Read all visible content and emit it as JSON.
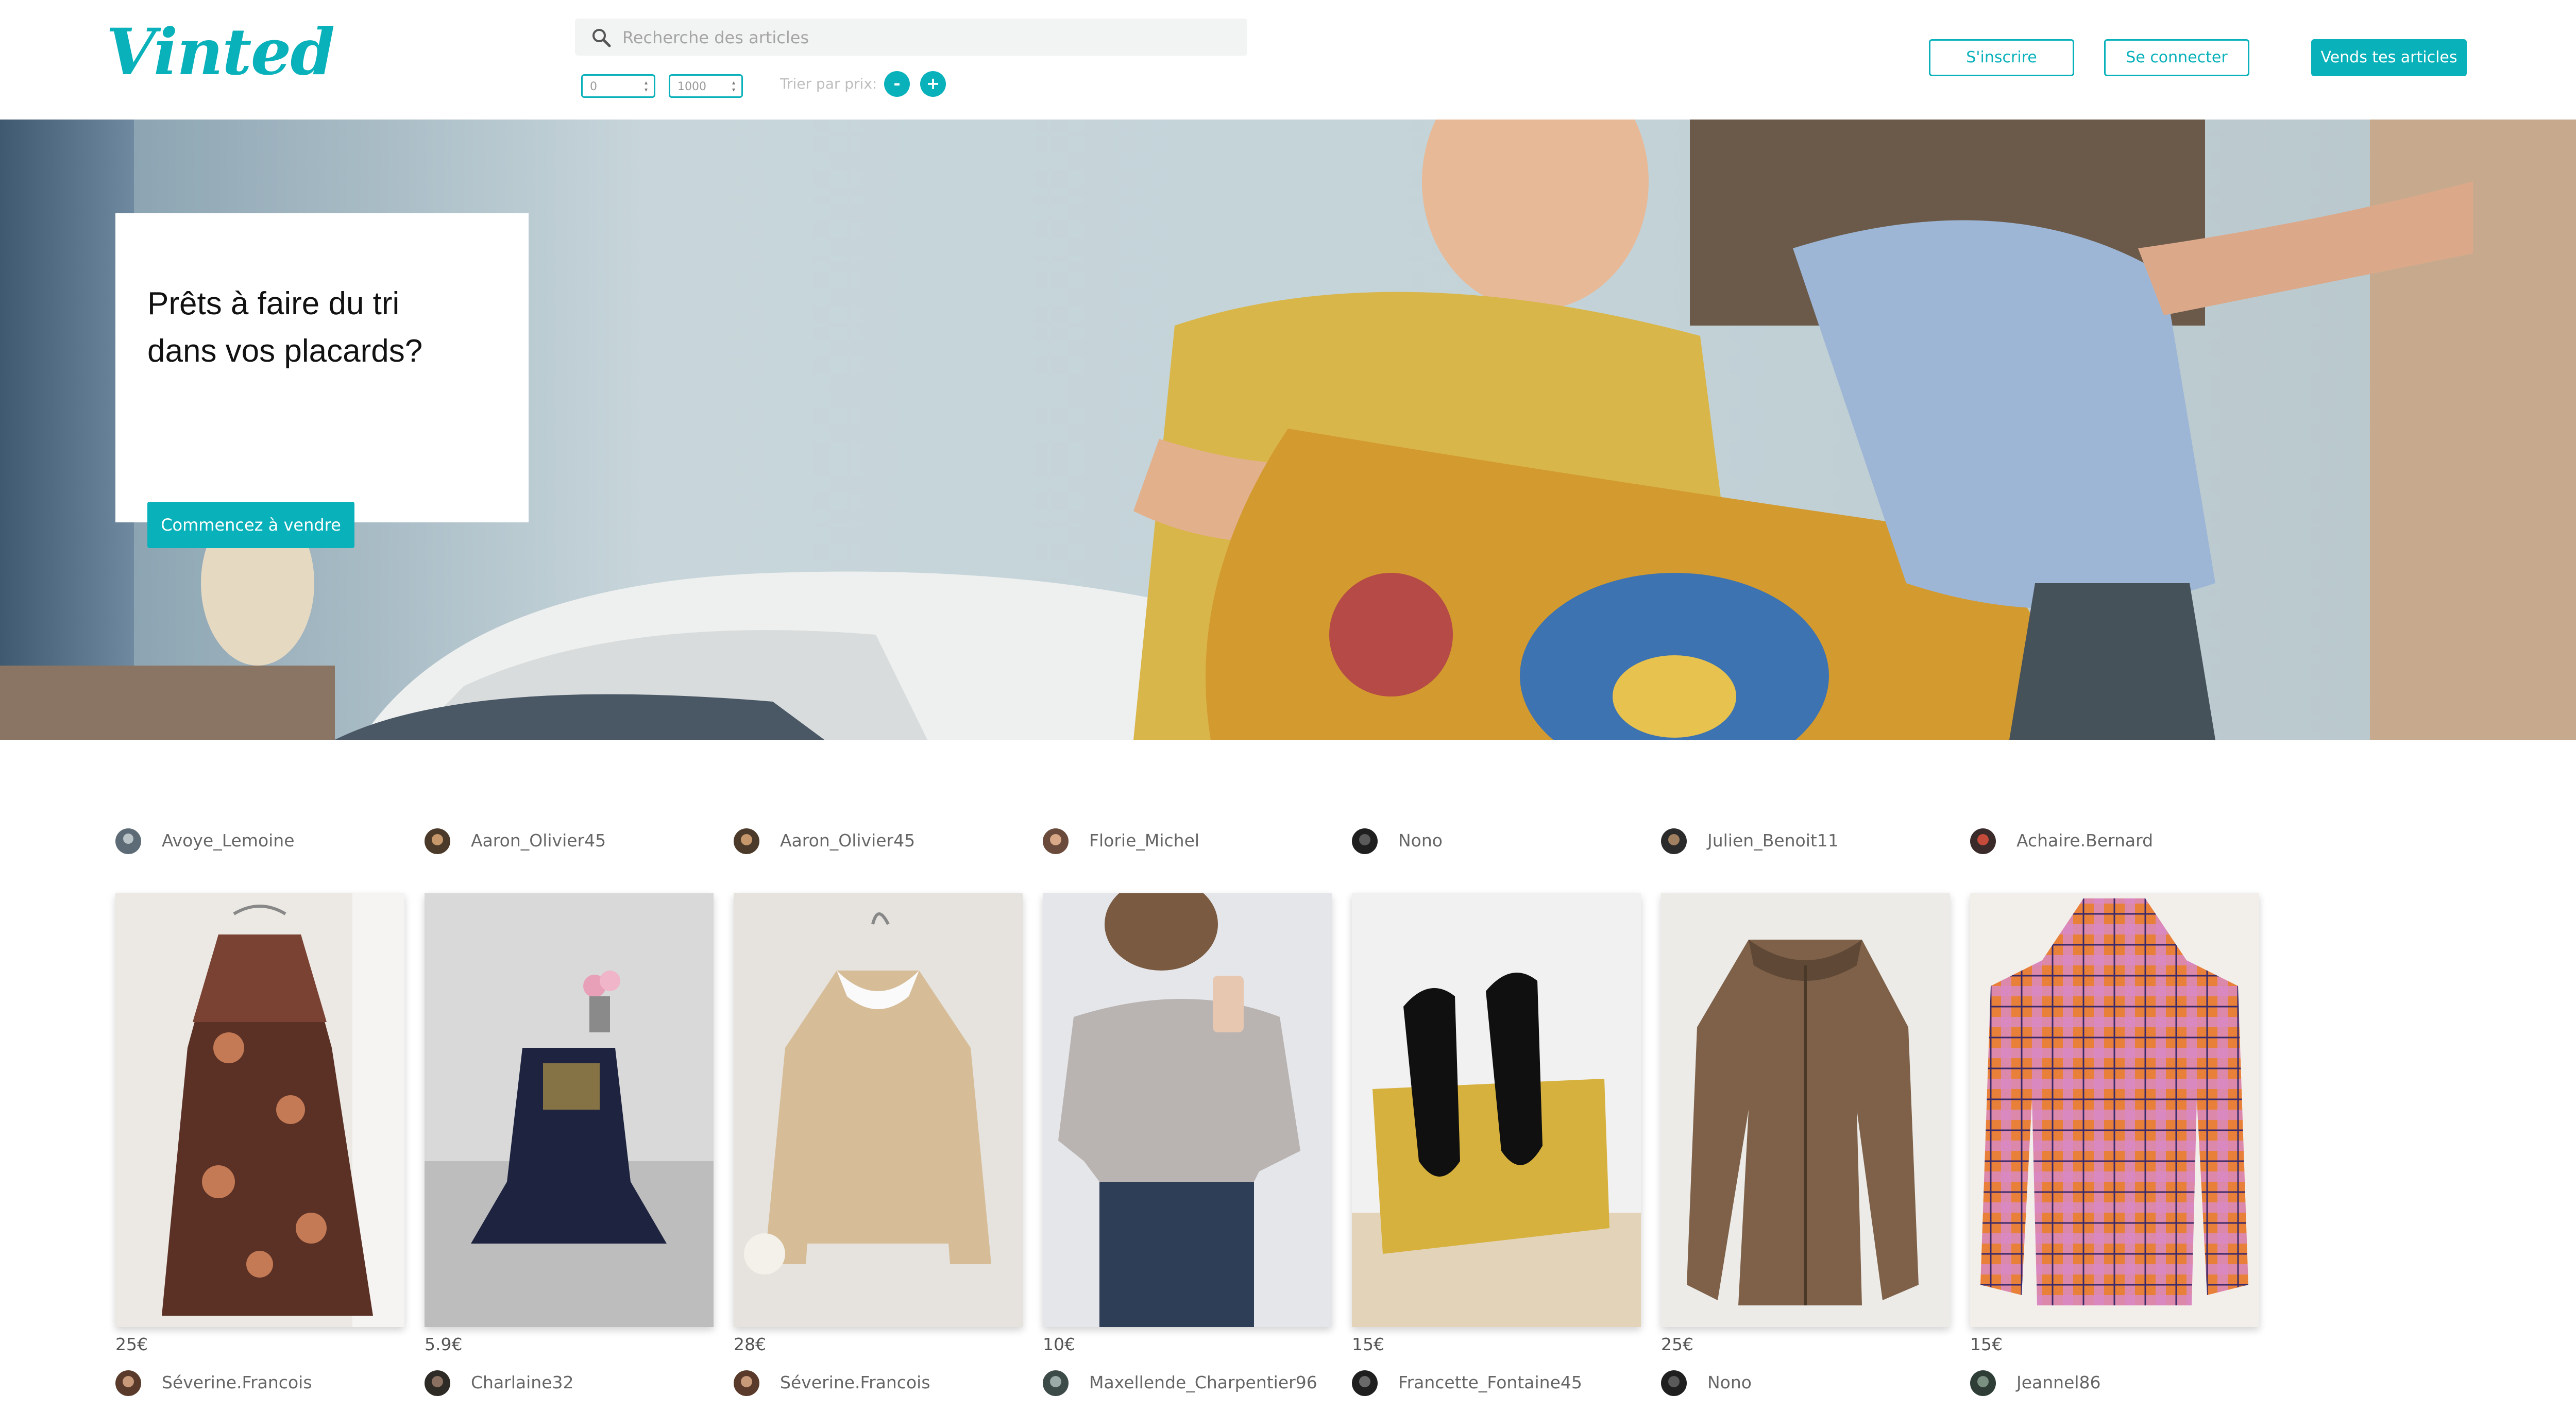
{
  "header": {
    "logo": "Vinted",
    "search_placeholder": "Recherche des articles",
    "price_min": "0",
    "price_max": "1000",
    "sort_label": "Trier par prix:",
    "sort_desc": "-",
    "sort_asc": "+",
    "signup": "S'inscrire",
    "login": "Se connecter",
    "sell": "Vends tes articles"
  },
  "hero": {
    "title": "Prêts à faire du tri dans vos placards?",
    "cta": "Commencez à vendre"
  },
  "colors": {
    "accent": "#09b1ba"
  },
  "items": [
    {
      "user": "Avoye_Lemoine",
      "price": "25€",
      "photo": "floral-dress"
    },
    {
      "user": "Aaron_Olivier45",
      "price": "5.9€",
      "photo": "navy-dress"
    },
    {
      "user": "Aaron_Olivier45",
      "price": "28€",
      "photo": "knit-sweater"
    },
    {
      "user": "Florie_Michel",
      "price": "10€",
      "photo": "grey-top"
    },
    {
      "user": "Nono",
      "price": "15€",
      "photo": "black-heels"
    },
    {
      "user": "Julien_Benoit11",
      "price": "25€",
      "photo": "brown-parka"
    },
    {
      "user": "Achaire.Bernard",
      "price": "15€",
      "photo": "plaid-shirt"
    }
  ],
  "next_row_users": [
    "Séverine.Francois",
    "Charlaine32",
    "Séverine.Francois",
    "Maxellende_Charpentier96",
    "Francette_Fontaine45",
    "Nono",
    "Jeannel86"
  ]
}
